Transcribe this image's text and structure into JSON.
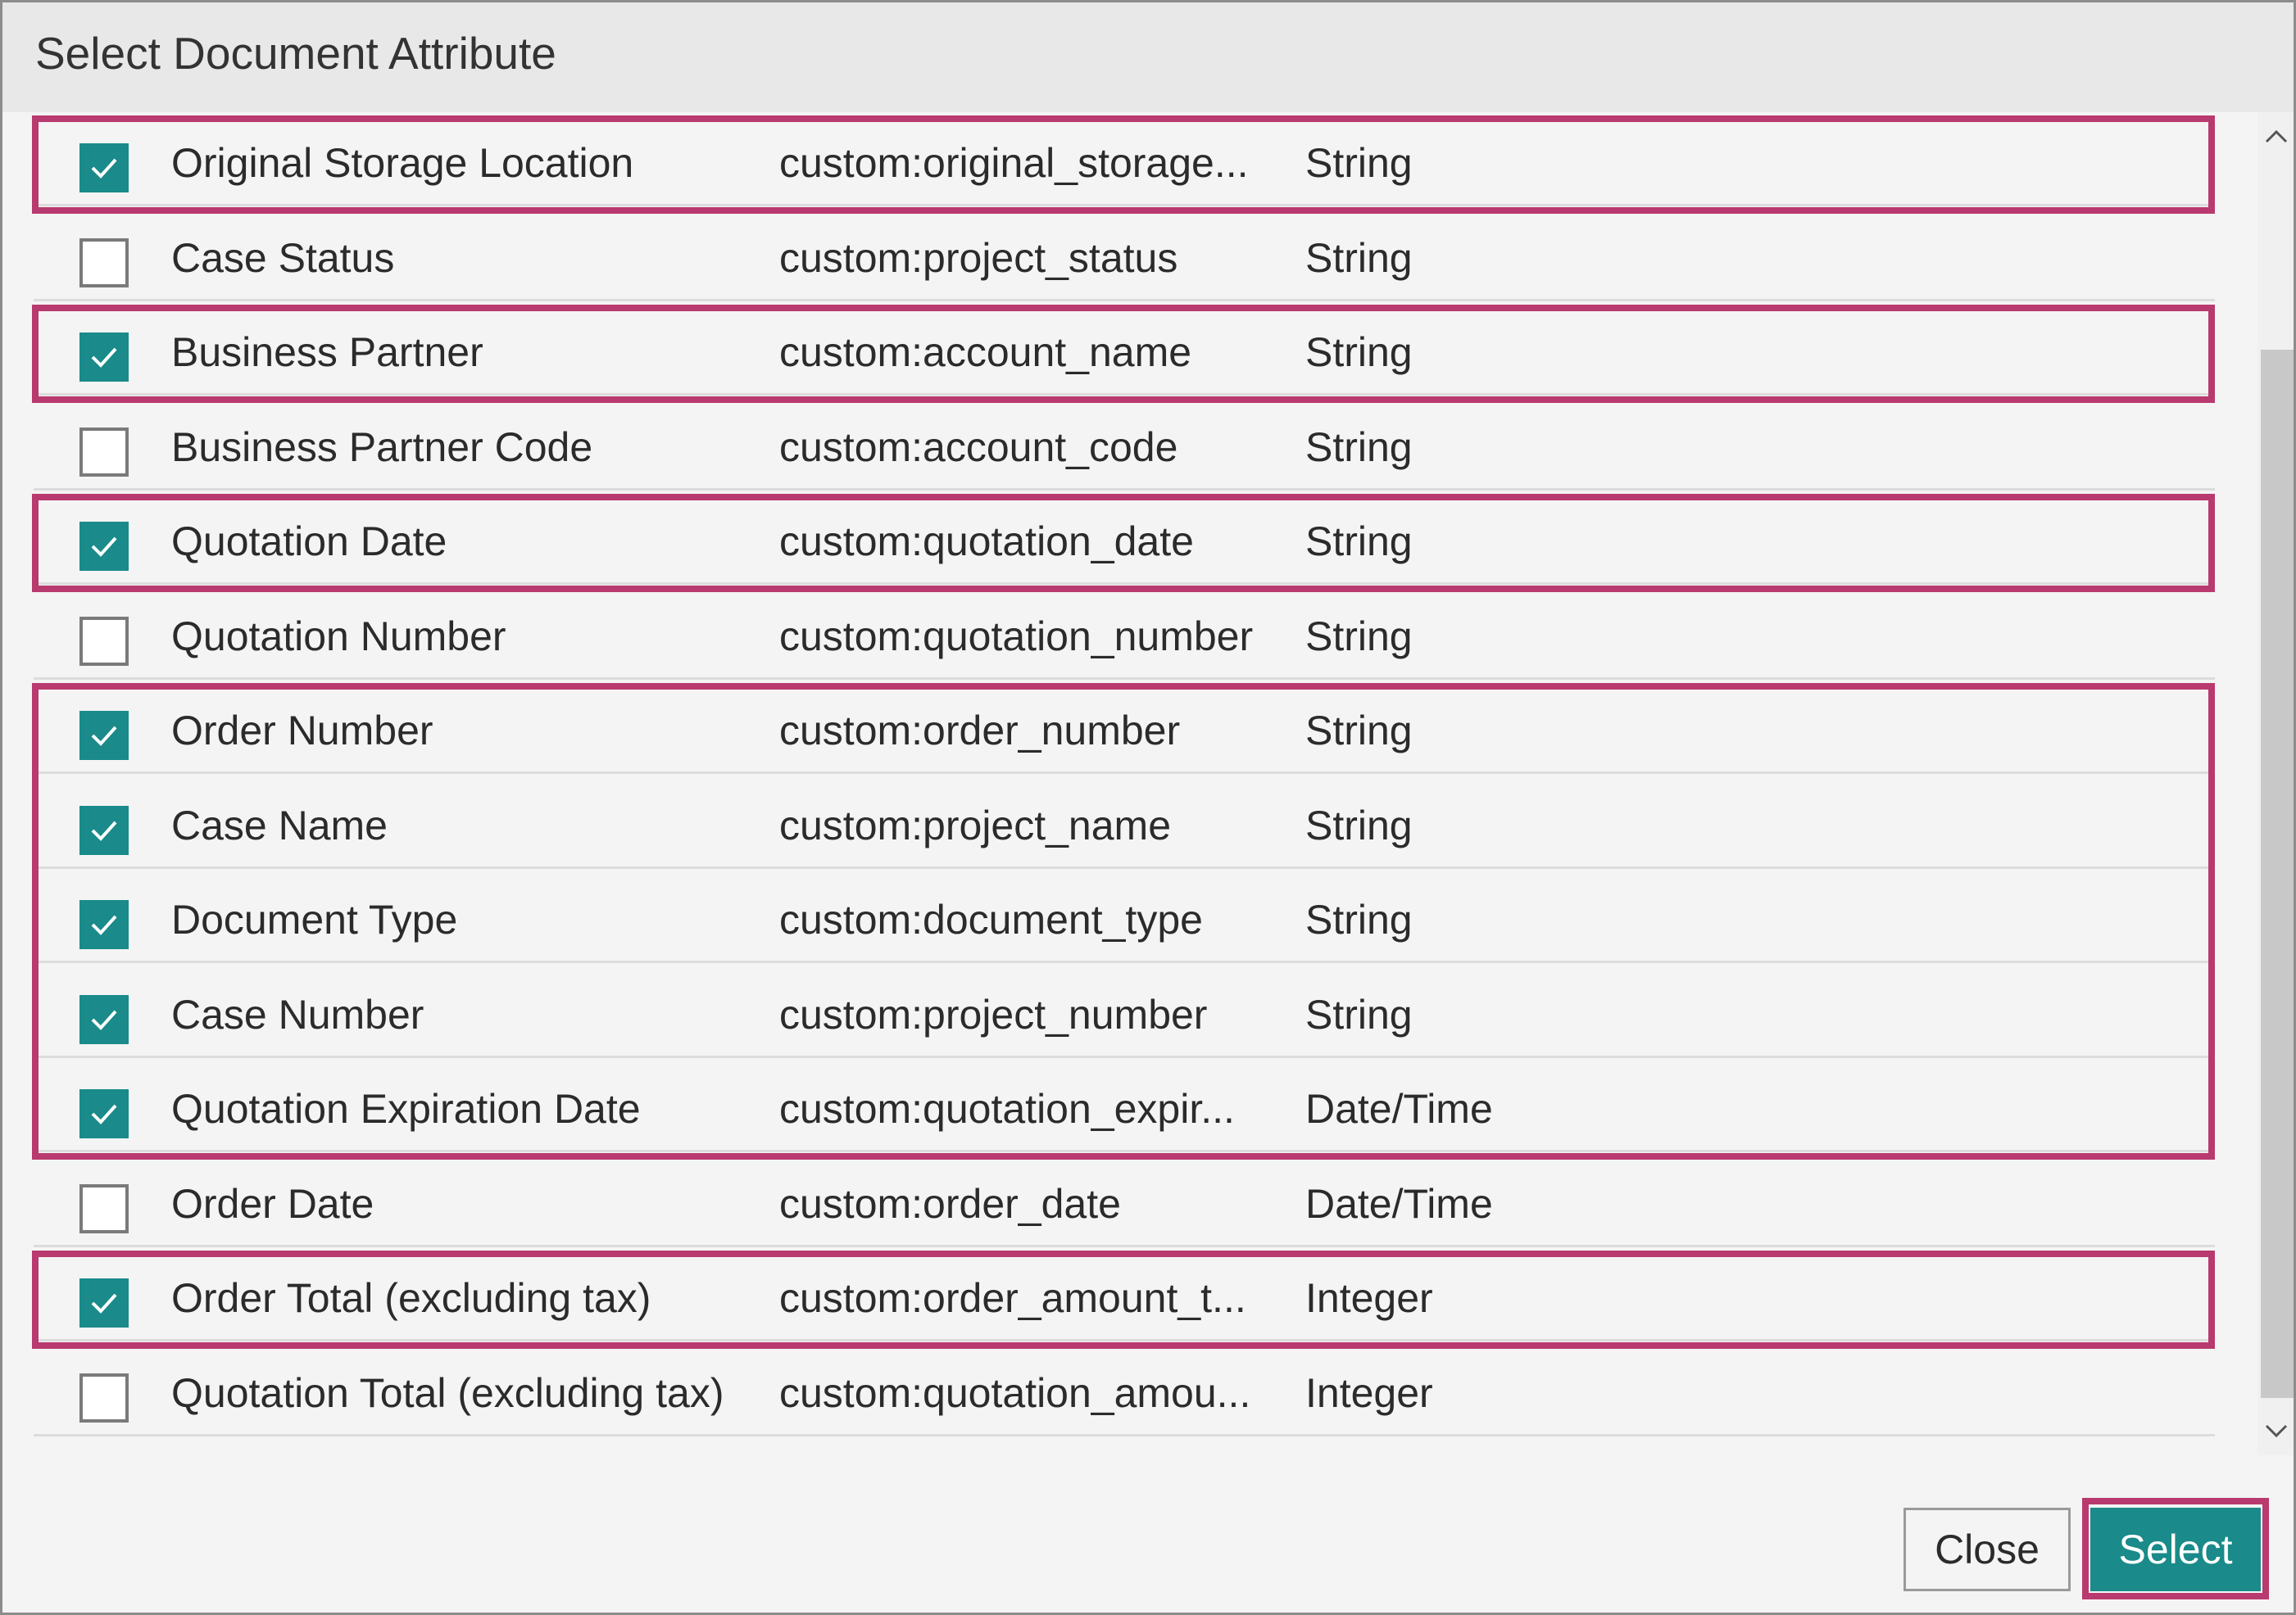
{
  "dialog": {
    "title": "Select Document Attribute"
  },
  "rows": [
    {
      "checked": true,
      "name": "Original Storage Location",
      "id": "custom:original_storage...",
      "type": "String",
      "highlighted": true
    },
    {
      "checked": false,
      "name": "Case Status",
      "id": "custom:project_status",
      "type": "String",
      "highlighted": false
    },
    {
      "checked": true,
      "name": "Business Partner",
      "id": "custom:account_name",
      "type": "String",
      "highlighted": true
    },
    {
      "checked": false,
      "name": "Business Partner Code",
      "id": "custom:account_code",
      "type": "String",
      "highlighted": false
    },
    {
      "checked": true,
      "name": "Quotation Date",
      "id": "custom:quotation_date",
      "type": "String",
      "highlighted": true
    },
    {
      "checked": false,
      "name": "Quotation Number",
      "id": "custom:quotation_number",
      "type": "String",
      "highlighted": false
    },
    {
      "checked": true,
      "name": "Order Number",
      "id": "custom:order_number",
      "type": "String",
      "highlighted": true
    },
    {
      "checked": true,
      "name": "Case Name",
      "id": "custom:project_name",
      "type": "String",
      "highlighted": true
    },
    {
      "checked": true,
      "name": "Document Type",
      "id": "custom:document_type",
      "type": "String",
      "highlighted": true
    },
    {
      "checked": true,
      "name": "Case Number",
      "id": "custom:project_number",
      "type": "String",
      "highlighted": true
    },
    {
      "checked": true,
      "name": "Quotation Expiration Date",
      "id": "custom:quotation_expir...",
      "type": "Date/Time",
      "highlighted": true
    },
    {
      "checked": false,
      "name": "Order Date",
      "id": "custom:order_date",
      "type": "Date/Time",
      "highlighted": false
    },
    {
      "checked": true,
      "name": "Order Total (excluding tax)",
      "id": "custom:order_amount_t...",
      "type": "Integer",
      "highlighted": true
    },
    {
      "checked": false,
      "name": "Quotation Total (excluding tax)",
      "id": "custom:quotation_amou...",
      "type": "Integer",
      "highlighted": false
    }
  ],
  "footer": {
    "close_label": "Close",
    "select_label": "Select"
  },
  "colors": {
    "accent": "#1a8a8a",
    "highlight": "#b83a6e"
  },
  "icons": {
    "checkbox_check": "check-icon",
    "scroll_up": "chevron-up-icon",
    "scroll_down": "chevron-down-icon"
  }
}
